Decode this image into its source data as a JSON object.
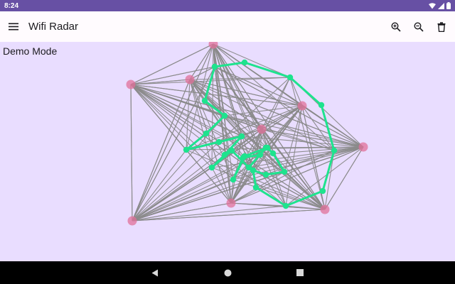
{
  "status_bar": {
    "time": "8:24",
    "icons": [
      "wifi-icon",
      "cell-signal-icon",
      "battery-icon"
    ]
  },
  "app_bar": {
    "title": "Wifi Radar",
    "navigation_icon": "menu-icon",
    "actions": [
      "zoom-in-icon",
      "zoom-out-icon",
      "delete-icon"
    ]
  },
  "main": {
    "mode_label": "Demo Mode"
  },
  "graph": {
    "colors": {
      "mesh_edge": "#8A8A8A",
      "path": "#1EE38E",
      "anchor": "#E0709A",
      "background": "#E9DDFF"
    }
  },
  "nav_bar": {
    "buttons": [
      "back-icon",
      "home-icon",
      "recents-icon"
    ]
  },
  "colors": {
    "status_bar": "#6750A4",
    "app_bar": "#FFFBFE",
    "nav_bar": "#000000"
  }
}
